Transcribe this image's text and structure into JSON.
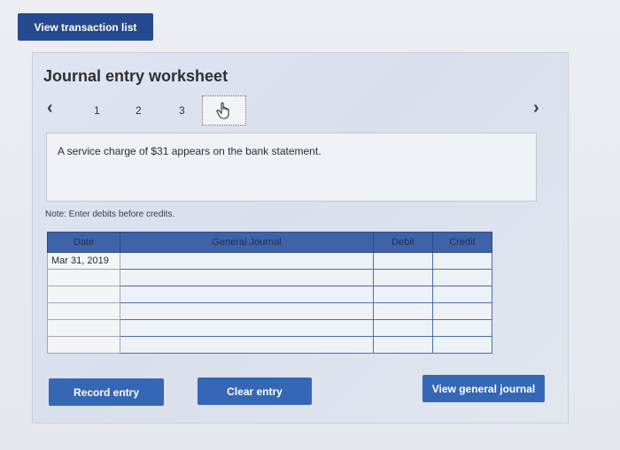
{
  "top": {
    "view_transaction_list": "View transaction list"
  },
  "worksheet": {
    "title": "Journal entry worksheet",
    "pager": {
      "pages": [
        "1",
        "2",
        "3"
      ],
      "current_icon": "hand-pointer-icon"
    },
    "description": "A service charge of $31 appears on the bank statement.",
    "note": "Note: Enter debits before credits."
  },
  "journal": {
    "headers": {
      "date": "Date",
      "account": "General Journal",
      "debit": "Debit",
      "credit": "Credit"
    },
    "rows": [
      {
        "date": "Mar 31, 2019",
        "account": "",
        "debit": "",
        "credit": ""
      },
      {
        "date": "",
        "account": "",
        "debit": "",
        "credit": ""
      },
      {
        "date": "",
        "account": "",
        "debit": "",
        "credit": ""
      },
      {
        "date": "",
        "account": "",
        "debit": "",
        "credit": ""
      },
      {
        "date": "",
        "account": "",
        "debit": "",
        "credit": ""
      },
      {
        "date": "",
        "account": "",
        "debit": "",
        "credit": ""
      }
    ]
  },
  "actions": {
    "record_entry": "Record entry",
    "clear_entry": "Clear entry",
    "view_general_journal": "View general journal"
  },
  "colors": {
    "primary_button": "#264a8f",
    "table_header": "#3e63a8",
    "action_button": "#3468b6"
  }
}
